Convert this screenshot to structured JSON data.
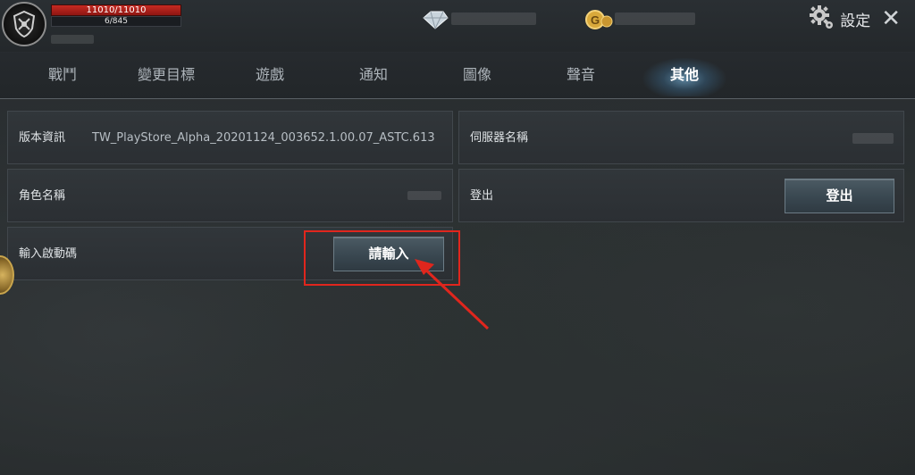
{
  "player": {
    "hp_text": "11010/11010",
    "mp_text": "6/845"
  },
  "header": {
    "settings_label": "設定",
    "close_symbol": "✕"
  },
  "tabs": [
    {
      "label": "戰鬥"
    },
    {
      "label": "變更目標"
    },
    {
      "label": "遊戲"
    },
    {
      "label": "通知"
    },
    {
      "label": "圖像"
    },
    {
      "label": "聲音"
    },
    {
      "label": "其他",
      "active": true
    }
  ],
  "rows": {
    "version": {
      "label": "版本資訊",
      "value": "TW_PlayStore_Alpha_20201124_003652.1.00.07_ASTC.613"
    },
    "server": {
      "label": "伺服器名稱"
    },
    "character": {
      "label": "角色名稱"
    },
    "logout": {
      "label": "登出",
      "button": "登出"
    },
    "activation": {
      "label": "輸入啟動碼",
      "button": "請輸入"
    }
  },
  "icons": {
    "emblem": "shield-crest-icon",
    "diamond": "diamond-icon",
    "coin": "gold-coin-icon",
    "gear": "gear-icon",
    "close": "close-icon",
    "arrow": "red-arrow-annotation"
  },
  "colors": {
    "hp": "#c62a22",
    "annotation": "#e0261d",
    "active_tab_glow": "#8cd2ff"
  }
}
